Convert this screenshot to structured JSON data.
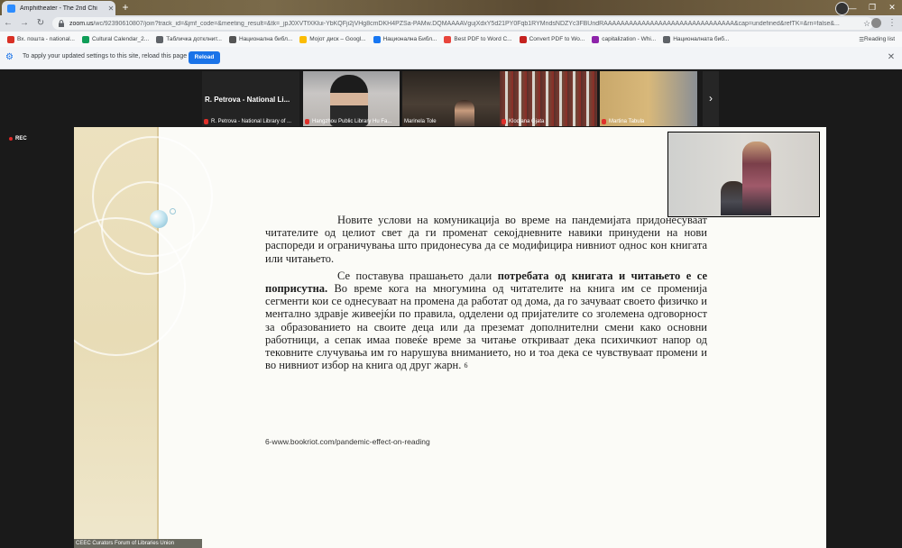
{
  "browser": {
    "tab_title": "Amphitheater - The 2nd Chi",
    "url_host": "zoom.us",
    "url_path": "/wc/92390610807/join?track_id=&jmf_code=&meeting_result=&tk=_jpJ0XVTfXKlui-YbKQFji2jVHg8cmDKH4PZSa-PAMw.DQMAAAAVgujXdxY5d21PY0Fqb1RYMndsNDZYc3FBUndRAAAAAAAAAAAAAAAAAAAAAAAAAAAAAAA&cap=undefined&refTK=&rn=false&...",
    "bookmarks": [
      {
        "label": "Вх. пошта - national...",
        "icon": "gmail-icon",
        "color": "#d93025"
      },
      {
        "label": "Cultural Calendar_2...",
        "icon": "sheets-icon",
        "color": "#0f9d58"
      },
      {
        "label": "Табличка дотклнит...",
        "icon": "doc-icon",
        "color": "#5f6368"
      },
      {
        "label": "Национална библ...",
        "icon": "site-icon",
        "color": "#555555"
      },
      {
        "label": "Мојот диск – Googl...",
        "icon": "drive-icon",
        "color": "#fbbc04"
      },
      {
        "label": "Национална Библ...",
        "icon": "facebook-icon",
        "color": "#1877f2"
      },
      {
        "label": "Best PDF to Word C...",
        "icon": "pdf-icon",
        "color": "#e8453c"
      },
      {
        "label": "Convert PDF to Wo...",
        "icon": "pdf-icon",
        "color": "#c5221f"
      },
      {
        "label": "capitalization - Whi...",
        "icon": "bookmark-icon",
        "color": "#8e24aa"
      },
      {
        "label": "Националната биб...",
        "icon": "globe-icon",
        "color": "#5f6368"
      }
    ],
    "reading_list": "Reading list"
  },
  "infobar": {
    "text": "To apply your updated settings to this site, reload this page",
    "reload_label": "Reload"
  },
  "meeting": {
    "recording_label": "REC",
    "participants": [
      {
        "name": "R. Petrova - National Library of ...",
        "display_name": "R. Petrova - National Li..."
      },
      {
        "name": "Hangzhou Public Library Hu Fa..."
      },
      {
        "name": "Marinela Tole"
      },
      {
        "name": "Klodjana Gjata"
      },
      {
        "name": "Martina Tabula"
      }
    ]
  },
  "slide": {
    "paragraph1": "Новите услови на комуникација во време на пандемијата придонесуваат читателите од целиот свет да ги променат секојдневните навики принудени на нови распореди и ограничувања што придонесува да се модифицира нивниот однос кон книгата или читањето.",
    "p2_intro": "Се поставува прашањето дали ",
    "p2_bold": "потребата од книгата и читањето е се поприсутна.",
    "p2_rest": " Во време кога на многумина од читателите на книга им се променија сегменти кои се однесуваат на промена да работат од дома,  да го зачуваат своето физичко и ментално здравје живеејќи по правила, одделени од пријателите со зголемена одговорност за образованието на своите деца или да преземат дополнителни смени како основни работници, а сепак имаа повеќе време за читање откриваат дека психичкиот напор од тековните случувања им го нарушува вниманието, но и тоа дека се чувствуваат промени и во нивниот избор на книга од друг жарн.",
    "footnote_ref": "6",
    "footnote": "6-www.bookriot.com/pandemic-effect-on-reading",
    "footer": "CEEC Curators Forum of Libraries Union"
  }
}
